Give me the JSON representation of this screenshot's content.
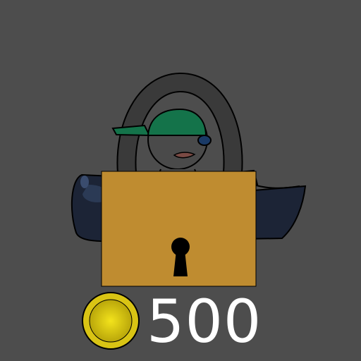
{
  "item": {
    "price": "500",
    "locked": true,
    "icon": "padlock-icon",
    "currency_icon": "coin-icon"
  },
  "colors": {
    "background": "#4d4d4d",
    "lock_body": "#bf8c30",
    "coin": "#d9c414",
    "cap": "#14734a",
    "backpack": "#1c2436"
  }
}
